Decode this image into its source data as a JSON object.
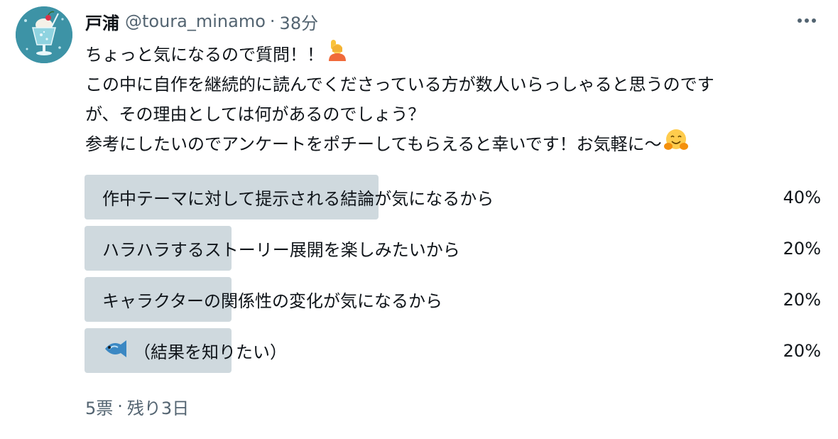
{
  "user": {
    "display_name": "戸浦",
    "handle": "@toura_minamo",
    "separator": "·",
    "time": "38分",
    "avatar_icon": "cream-soda-avatar-icon"
  },
  "more_icon": "more-horizontal-icon",
  "tweet": {
    "lines": [
      "ちょっと気になるので質問！！",
      "この中に自作を継続的に読んでくださっている方が数人いらっしゃると思うのです",
      "が、その理由としては何があるのでしょう？",
      "参考にしたいのでアンケートをポチーしてもらえると幸いです！お気軽に〜"
    ],
    "emoji": {
      "line1": "raising-hand-icon",
      "line4": "hugging-face-icon"
    }
  },
  "poll": {
    "options": [
      {
        "label": "作中テーマに対して提示される結論が気になるから",
        "percent_text": "40%",
        "percent": 40
      },
      {
        "label": "ハラハラするストーリー展開を楽しみたいから",
        "percent_text": "20%",
        "percent": 20
      },
      {
        "label": "キャラクターの関係性の変化が気になるから",
        "percent_text": "20%",
        "percent": 20
      },
      {
        "label": "（結果を知りたい）",
        "percent_text": "20%",
        "percent": 20,
        "icon": "fish-icon"
      }
    ],
    "votes": "5票",
    "separator": "·",
    "remaining": "残り3日"
  },
  "colors": {
    "bar": "#cfd9de",
    "muted_text": "#536471",
    "main_text": "#0f1419",
    "avatar_bg": "#3d93a6"
  }
}
